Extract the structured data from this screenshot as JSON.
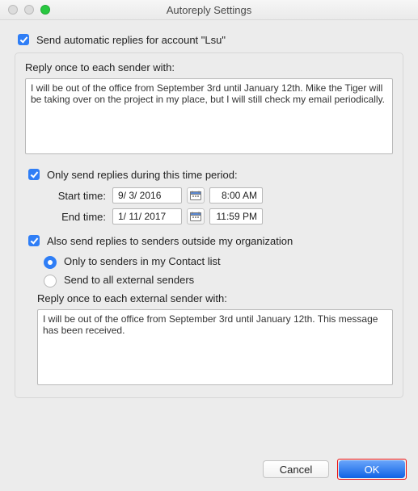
{
  "window": {
    "title": "Autoreply Settings"
  },
  "top": {
    "send_automatic_label": "Send automatic replies for account \"Lsu\"",
    "send_automatic_checked": true
  },
  "internal": {
    "section_label": "Reply once to each sender with:",
    "reply_text": "I will be out of the office from September 3rd until January 12th. Mike the Tiger will be taking over on the project in my place, but I will still check my email periodically."
  },
  "time_period": {
    "enabled": true,
    "label": "Only send replies during this time period:",
    "start_label": "Start time:",
    "end_label": "End time:",
    "start_date": "9/ 3/ 2016",
    "end_date": "1/ 11/ 2017",
    "start_time": "8:00 AM",
    "end_time": "11:59 PM"
  },
  "external": {
    "enabled": true,
    "send_external_label": "Also send replies to senders outside my organization",
    "option_contacts_label": "Only to senders in my Contact list",
    "option_all_label": "Send to all external senders",
    "option_selected": "contacts",
    "section_label": "Reply once to each external sender with:",
    "reply_text": "I will be out of the office from September 3rd until January 12th. This message has been received."
  },
  "footer": {
    "cancel_label": "Cancel",
    "ok_label": "OK"
  },
  "icons": {
    "calendar": "calendar-icon"
  }
}
